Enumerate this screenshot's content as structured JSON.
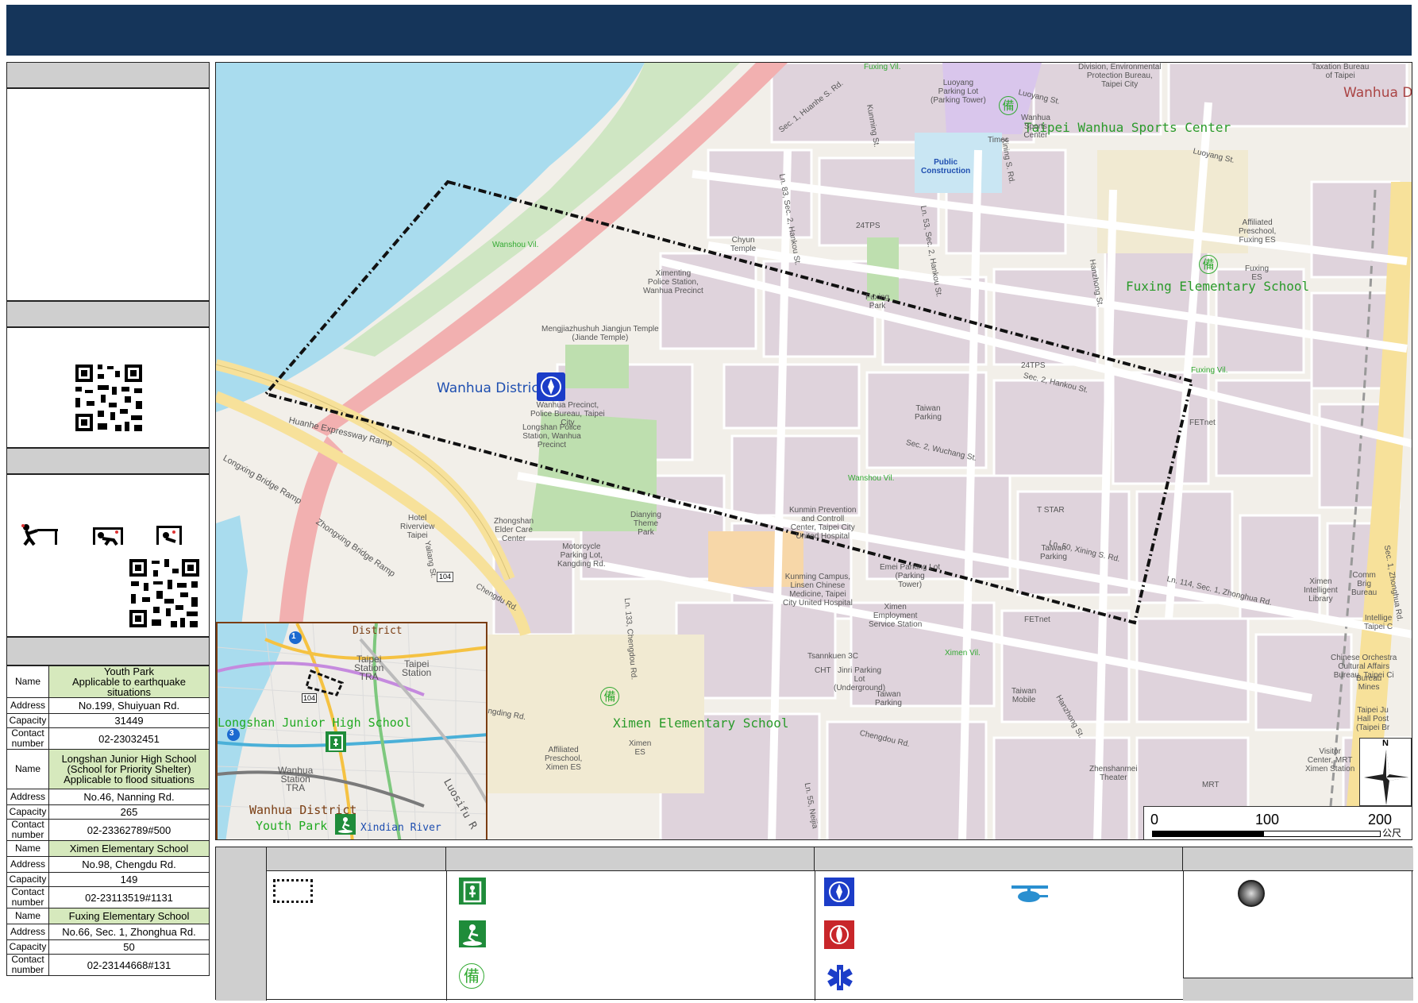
{
  "map": {
    "district_label": "Wanhua District",
    "areas": {
      "sports_center": "Taipei Wanhua Sports Center",
      "fuxing_school": "Fuxing Elementary School",
      "ximen_school": "Ximen Elementary School",
      "wanhua_top_right": "Wanhua D",
      "wanshou_vil": "Wanshou Vil.",
      "wanshou_vil_2": "Wanshou Vil.",
      "fuxing_vil_top": "Fuxing Vil.",
      "fuxing_vil": "Fuxing Vil.",
      "ximen_vil": "Ximen Vil.",
      "public_construction": "Public\nConstruction"
    },
    "roads": {
      "huanhe_expressway_ramp": "Huanhe Expressway Ramp",
      "longxing_bridge_ramp": "Longxing Bridge Ramp",
      "zhongxing_bridge_ramp": "Zhongxing Bridge Ramp",
      "huanhe_s_rd": "Sec. 1, Huanhe S. Rd.",
      "wuchang_st": "Sec. 2, Wuchang St.",
      "xining_s_rd": "Ln. 50, Xining S. Rd.",
      "zhonghua_rd": "Sec. 1, Zhonghua Rd.",
      "zhonghua_ln114": "Ln. 114, Sec. 1, Zhonghua Rd.",
      "chengdu_rd": "Chengdu Rd.",
      "chengdou_rd": "Chengdou Rd.",
      "kangding_rd": "Kangding Rd.",
      "hankou_ln83": "Ln. 83, Sec. 2, Hankou St.",
      "hankou_ln53": "Ln. 53, Sec. 2, Hankou St.",
      "hankou_st": "Sec. 2, Hankou St.",
      "chengdu_ln133": "Ln. 133, Chengdou Rd.",
      "kunming_st": "Kunming St.",
      "xining_s": "Xining S. Rd.",
      "luoyang_st": "Luoyang St.",
      "luoyang_st_2": "Luoyang St.",
      "yaliang_st": "Yaliang St.",
      "hanzhong_st": "Hanzhong St.",
      "hanzhong_st_2": "Hanzhong St.",
      "ln55": "Ln. 55, Neijia",
      "shield_104": "104"
    },
    "pois": [
      "Luoyang\nParking Lot\n(Parking Tower)",
      "Times",
      "Wanhua\nSports\nCenter",
      "Division, Environmental\nProtection Bureau,\nTaipei City",
      "Taxation Bureau\nof Taipei",
      "24TPS",
      "Chyun\nTemple",
      "Ximenting\nPolice Station,\nWanhua Precinct",
      "Mengjiazhushuh Jiangjun Temple\n(Jiande Temple)",
      "Fuxing\nPark",
      "Affiliated\nPreschool,\nFuxing ES",
      "Fuxing\nES",
      "24TPS",
      "Taiwan\nParking",
      "Wanhua Precinct,\nPolice Bureau, Taipei\nCity",
      "Longshan Police\nStation, Wanhua\nPrecinct",
      "FETnet",
      "Hotel\nRiverview\nTaipei",
      "Zhongshan\nElder Care\nCenter",
      "Motorcycle\nParking Lot,\nKangding Rd.",
      "Dianying\nTheme\nPark",
      "Kunmin Prevention\nand Controll\nCenter, Taipei City\nUnited Hospital",
      "T STAR",
      "Taiwan\nParking",
      "Emei Parking Lot\n(Parking\nTower)",
      "Kunming Campus,\nLinsen Chinese\nMedicine, Taipei\nCity United Hospital",
      "Ximen\nEmployment\nService Station",
      "FETnet",
      "Tsannkuen 3C",
      "CHT",
      "Jinri Parking\nLot\n(Underground)",
      "Taiwan\nParking",
      "Taiwan\nMobile",
      "Ximen\nES",
      "Affiliated\nPreschool,\nXimen ES",
      "Zhenshanmei\nTheater",
      "Visitor\nCenter, MRT\nXimen Station",
      "MRT",
      "Ximen\nIntelligent\nLibrary",
      "Comm\nBrig\nBureau",
      "Intellige\nTaipei C",
      "Chinese Orchestra\nCultural Affairs\nBureau, Taipei Ci",
      "Bureau\nMines",
      "Taipei Ju\nHall Post\n(Taipei Br"
    ],
    "scale": {
      "ticks": [
        "0",
        "100",
        "200"
      ],
      "unit": "公尺"
    },
    "compass": "N"
  },
  "inset": {
    "labels": {
      "district": "District",
      "taipei_station_tra": "Taipei\nStation\nTRA",
      "taipei_station": "Taipei\nStation",
      "longshan_jhs": "Longshan Junior High School",
      "wanhua_station": "Wanhua\nStation\nTRA",
      "wanhua_district": "Wanhua District",
      "youth_park": "Youth Park",
      "river": "Xindian River",
      "luosifu": "Luosifu R",
      "shield_104": "104",
      "shield_1": "1",
      "shield_3": "3"
    }
  },
  "shelters": [
    {
      "name_label": "Name",
      "name": "Youth Park\nApplicable to earthquake situations",
      "address_label": "Address",
      "address": "No.199, Shuiyuan Rd.",
      "capacity_label": "Capacity",
      "capacity": "31449",
      "contact_label": "Contact\nnumber",
      "contact": "02-23032451"
    },
    {
      "name_label": "Name",
      "name": "Longshan Junior High School\n(School for Priority Shelter)\nApplicable to flood situations",
      "address_label": "Address",
      "address": "No.46, Nanning Rd.",
      "capacity_label": "Capacity",
      "capacity": "265",
      "contact_label": "Contact\nnumber",
      "contact": "02-23362789#500"
    },
    {
      "name_label": "Name",
      "name": "Ximen Elementary School",
      "address_label": "Address",
      "address": "No.98, Chengdu Rd.",
      "capacity_label": "Capacity",
      "capacity": "149",
      "contact_label": "Contact\nnumber",
      "contact": "02-23113519#1131"
    },
    {
      "name_label": "Name",
      "name": "Fuxing Elementary School",
      "address_label": "Address",
      "address": "No.66, Sec. 1, Zhonghua Rd.",
      "capacity_label": "Capacity",
      "capacity": "50",
      "contact_label": "Contact\nnumber",
      "contact": "02-23144668#131"
    }
  ],
  "legend": {
    "icons": [
      "boundary-dashed-icon",
      "shelter-indoor-icon",
      "shelter-outdoor-icon",
      "backup-shelter-icon",
      "police-icon",
      "fire-department-icon",
      "medical-star-icon",
      "helicopter-icon",
      "aed-circle-icon"
    ],
    "backup_glyph": "備"
  },
  "colors": {
    "header": "#15355a",
    "river": "#a9dcee",
    "land": "#f2efe9",
    "block": "#dfd3dc",
    "park": "#bedfaf",
    "school_label": "#22aa22",
    "district_label": "#1f4fb0",
    "shelter_green": "#1f8c3a",
    "highlight_green": "#d6e9bd"
  }
}
